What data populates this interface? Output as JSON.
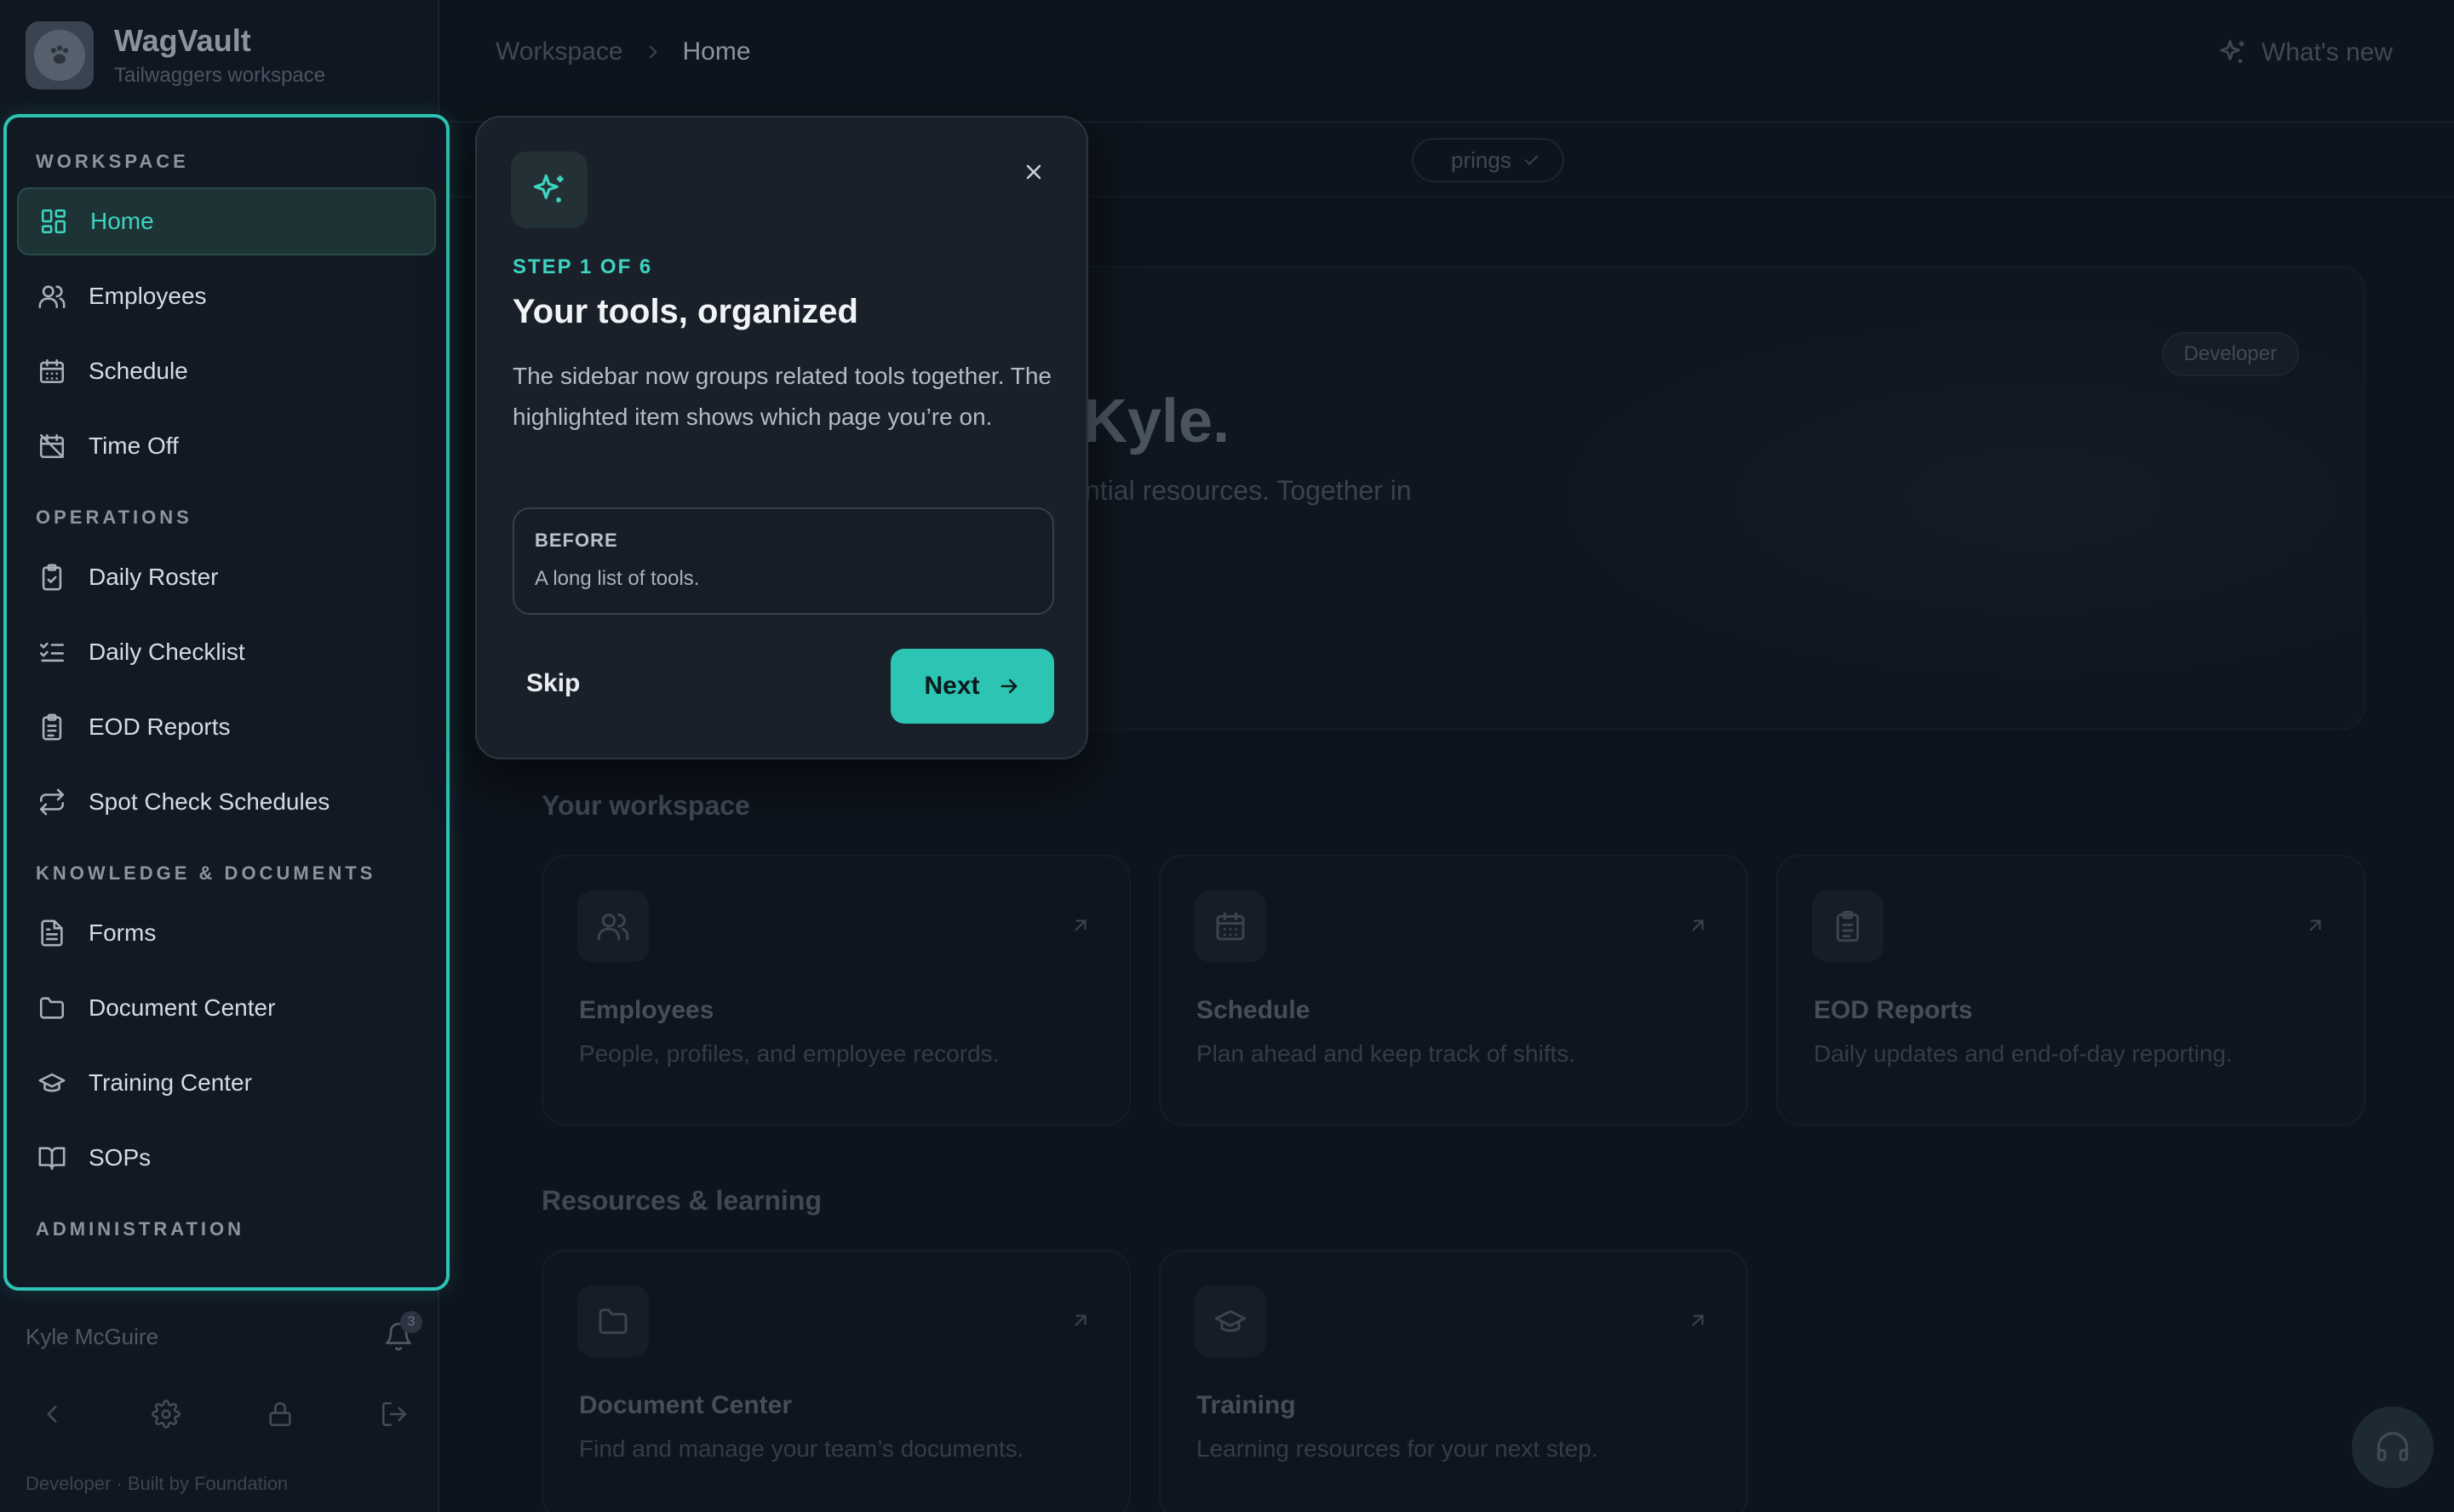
{
  "app": {
    "name": "WagVault",
    "workspace": "Tailwaggers workspace"
  },
  "colors": {
    "accent": "#2cc4b2",
    "background": "#0e141d"
  },
  "sidebar": {
    "sections": [
      {
        "title": "WORKSPACE",
        "items": [
          {
            "label": "Home",
            "icon": "dashboard-icon",
            "active": true
          },
          {
            "label": "Employees",
            "icon": "users-icon"
          },
          {
            "label": "Schedule",
            "icon": "calendar-icon"
          },
          {
            "label": "Time Off",
            "icon": "calendar-off-icon"
          }
        ]
      },
      {
        "title": "OPERATIONS",
        "items": [
          {
            "label": "Daily Roster",
            "icon": "clipboard-check-icon"
          },
          {
            "label": "Daily Checklist",
            "icon": "list-checks-icon"
          },
          {
            "label": "EOD Reports",
            "icon": "clipboard-list-icon"
          },
          {
            "label": "Spot Check Schedules",
            "icon": "repeat-icon"
          }
        ]
      },
      {
        "title": "KNOWLEDGE & DOCUMENTS",
        "items": [
          {
            "label": "Forms",
            "icon": "file-text-icon"
          },
          {
            "label": "Document Center",
            "icon": "folder-icon"
          },
          {
            "label": "Training Center",
            "icon": "graduation-cap-icon"
          },
          {
            "label": "SOPs",
            "icon": "book-open-icon"
          }
        ]
      },
      {
        "title": "ADMINISTRATION",
        "items": []
      }
    ],
    "user_name": "Kyle McGuire",
    "notification_count": "3",
    "footer": "Developer · Built by Foundation"
  },
  "header": {
    "breadcrumb": [
      "Workspace",
      "Home"
    ],
    "whats_new": "What's new"
  },
  "filter": {
    "chip_label": "prings"
  },
  "hero": {
    "greeting": "Kyle.",
    "subtitle": "ntial resources. Together in",
    "badge": "Developer"
  },
  "workspace_section": {
    "title": "Your workspace",
    "cards": [
      {
        "title": "Employees",
        "desc": "People, profiles, and employee records.",
        "icon": "users-icon"
      },
      {
        "title": "Schedule",
        "desc": "Plan ahead and keep track of shifts.",
        "icon": "calendar-icon"
      },
      {
        "title": "EOD Reports",
        "desc": "Daily updates and end-of-day reporting.",
        "icon": "clipboard-list-icon"
      }
    ]
  },
  "resources_section": {
    "title": "Resources & learning",
    "cards": [
      {
        "title": "Document Center",
        "desc": "Find and manage your team’s documents.",
        "icon": "folder-icon"
      },
      {
        "title": "Training",
        "desc": "Learning resources for your next step.",
        "icon": "graduation-cap-icon"
      }
    ]
  },
  "tour": {
    "step": "STEP 1 OF 6",
    "title": "Your tools, organized",
    "body": "The sidebar now groups related tools together. The highlighted item shows which page you’re on.",
    "before_label": "BEFORE",
    "before_text": "A long list of tools.",
    "skip": "Skip",
    "next": "Next"
  }
}
